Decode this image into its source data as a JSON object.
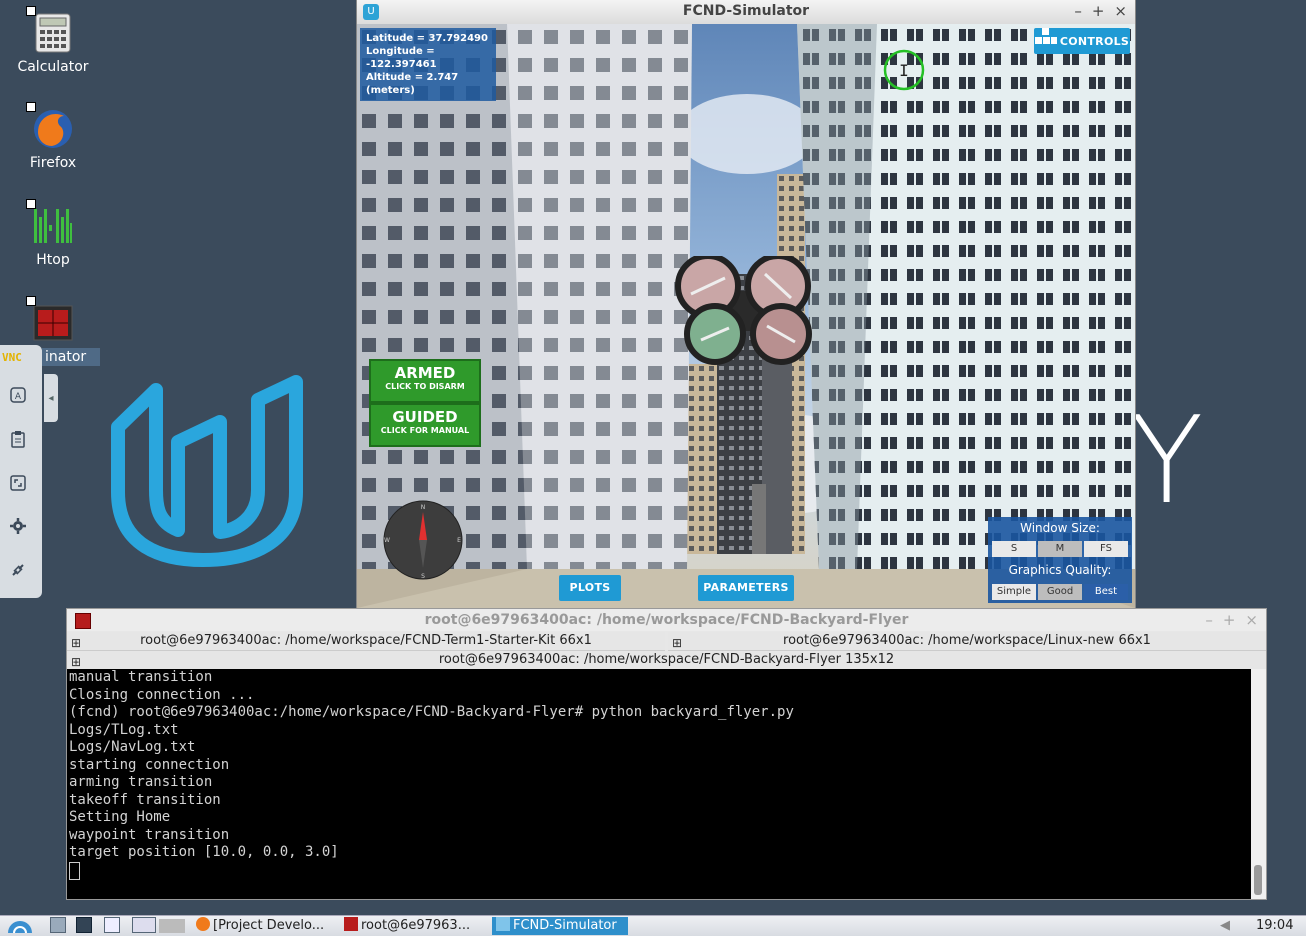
{
  "desktop": {
    "icons": [
      {
        "label": "Calculator",
        "icon": "calculator-icon"
      },
      {
        "label": "Firefox",
        "icon": "firefox-icon"
      },
      {
        "label": "Htop",
        "icon": "htop-icon"
      },
      {
        "label": "inator",
        "icon": "terminator-icon"
      }
    ],
    "logo_text": "Y"
  },
  "vnc": {
    "tag": "VNC",
    "buttons": [
      "keyboard-icon",
      "clipboard-icon",
      "fullscreen-icon",
      "settings-icon",
      "disconnect-icon"
    ]
  },
  "simulator": {
    "title": "FCND-Simulator",
    "telemetry": {
      "latitude": "Latitude = 37.792490",
      "longitude": "Longitude = -122.397461",
      "altitude": "Altitude = 2.747 (meters)"
    },
    "controls_label": "CONTROLS",
    "armed": {
      "title": "ARMED",
      "subtitle": "CLICK TO DISARM"
    },
    "guided": {
      "title": "GUIDED",
      "subtitle": "CLICK FOR MANUAL"
    },
    "compass": {
      "n": "N",
      "s": "S",
      "e": "E",
      "w": "W"
    },
    "plots_label": "PLOTS",
    "parameters_label": "PARAMETERS",
    "window_size": {
      "label": "Window Size:",
      "options": [
        "S",
        "M",
        "FS"
      ],
      "selected": "M"
    },
    "graphics_quality": {
      "label": "Graphics Quality:",
      "options": [
        "Simple",
        "Good",
        "Best"
      ],
      "selected": "Good"
    }
  },
  "terminal": {
    "title": "root@6e97963400ac: /home/workspace/FCND-Backyard-Flyer",
    "panes": {
      "left": "root@6e97963400ac: /home/workspace/FCND-Term1-Starter-Kit 66x1",
      "right": "root@6e97963400ac: /home/workspace/Linux-new 66x1",
      "main": "root@6e97963400ac: /home/workspace/FCND-Backyard-Flyer 135x12"
    },
    "lines": [
      "manual transition",
      "Closing connection ...",
      "(fcnd) root@6e97963400ac:/home/workspace/FCND-Backyard-Flyer# python backyard_flyer.py",
      "Logs/TLog.txt",
      "Logs/NavLog.txt",
      "starting connection",
      "arming transition",
      "takeoff transition",
      "Setting Home",
      "waypoint transition",
      "target position [10.0, 0.0, 3.0]"
    ]
  },
  "taskbar": {
    "items": [
      {
        "label": "[Project Develo...",
        "icon": "firefox-icon",
        "active": false
      },
      {
        "label": "root@6e97963...",
        "icon": "terminal-icon",
        "active": false
      },
      {
        "label": "FCND-Simulator",
        "icon": "simulator-icon",
        "active": true
      }
    ],
    "clock": "19:04"
  }
}
